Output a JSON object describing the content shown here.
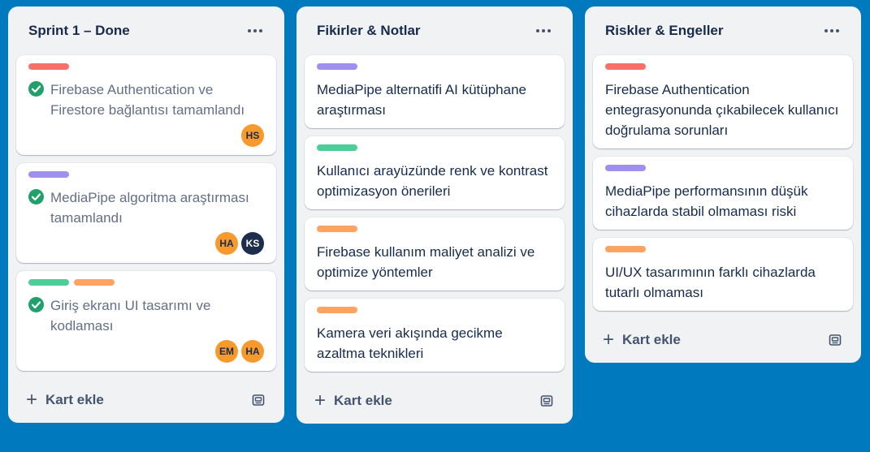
{
  "colors": {
    "board_bg": "#0079bf",
    "list_bg": "#f1f2f4",
    "red": "#f87168",
    "purple": "#9f8fef",
    "green": "#4bce97",
    "orange": "#fea362",
    "avatar_orange": "#f79a2b",
    "avatar_navy": "#1d2d4c",
    "check_green": "#22a06b"
  },
  "lists": [
    {
      "title": "Sprint 1 – Done",
      "add_card": "Kart ekle",
      "cards": [
        {
          "text": "Firebase Authentication ve Firestore bağlantısı tamamlandı",
          "labels": [
            "red"
          ],
          "done": true,
          "members": [
            "HS"
          ]
        },
        {
          "text": "MediaPipe algoritma araştırması tamamlandı",
          "labels": [
            "purple"
          ],
          "done": true,
          "members": [
            "HA",
            "KS"
          ]
        },
        {
          "text": "Giriş ekranı UI tasarımı ve kodlaması",
          "labels": [
            "green",
            "orange"
          ],
          "done": true,
          "members": [
            "EM",
            "HA"
          ]
        }
      ]
    },
    {
      "title": "Fikirler & Notlar",
      "add_card": "Kart ekle",
      "cards": [
        {
          "text": "MediaPipe alternatifi AI kütüphane araştırması",
          "labels": [
            "purple"
          ]
        },
        {
          "text": "Kullanıcı arayüzünde renk ve kontrast optimizasyon önerileri",
          "labels": [
            "green"
          ]
        },
        {
          "text": "Firebase kullanım maliyet analizi ve optimize yöntemler",
          "labels": [
            "orange"
          ]
        },
        {
          "text": "Kamera veri akışında gecikme azaltma teknikleri",
          "labels": [
            "orange"
          ]
        }
      ]
    },
    {
      "title": "Riskler & Engeller",
      "add_card": "Kart ekle",
      "cards": [
        {
          "text": "Firebase Authentication entegrasyonunda çıkabilecek kullanıcı doğrulama sorunları",
          "labels": [
            "red"
          ]
        },
        {
          "text": "MediaPipe performansının düşük cihazlarda stabil olmaması riski",
          "labels": [
            "purple"
          ]
        },
        {
          "text": "UI/UX tasarımının farklı cihazlarda tutarlı olmaması",
          "labels": [
            "orange"
          ]
        }
      ]
    }
  ]
}
